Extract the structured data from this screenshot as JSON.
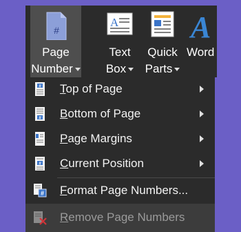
{
  "ribbon": {
    "page_number": {
      "line1": "Page",
      "line2": "Number",
      "icon": "page-number-icon"
    },
    "text_box": {
      "line1": "Text",
      "line2": "Box",
      "icon": "text-box-icon"
    },
    "quick_parts": {
      "line1": "Quick",
      "line2": "Parts",
      "icon": "quick-parts-icon"
    },
    "wordart": {
      "line1": "Word",
      "icon": "wordart-icon"
    }
  },
  "menu": {
    "items": [
      {
        "accel": "T",
        "rest": "op of Page",
        "icon": "top-of-page-icon",
        "submenu": true
      },
      {
        "accel": "B",
        "rest": "ottom of Page",
        "icon": "bottom-of-page-icon",
        "submenu": true
      },
      {
        "accel": "P",
        "rest": "age Margins",
        "icon": "page-margins-icon",
        "submenu": true
      },
      {
        "accel": "C",
        "rest": "urrent Position",
        "icon": "current-position-icon",
        "submenu": true
      },
      {
        "accel": "F",
        "rest": "ormat Page Numbers...",
        "icon": "format-page-numbers-icon",
        "submenu": false
      },
      {
        "accel": "R",
        "rest": "emove Page Numbers",
        "icon": "remove-page-numbers-icon",
        "submenu": false,
        "disabled": true
      }
    ]
  },
  "colors": {
    "background": "#6b5fc6",
    "ribbon": "#2b2b2b",
    "active_button": "#4e4e4e",
    "page_icon_blue": "#3a74c8",
    "remove_red": "#d13438"
  }
}
